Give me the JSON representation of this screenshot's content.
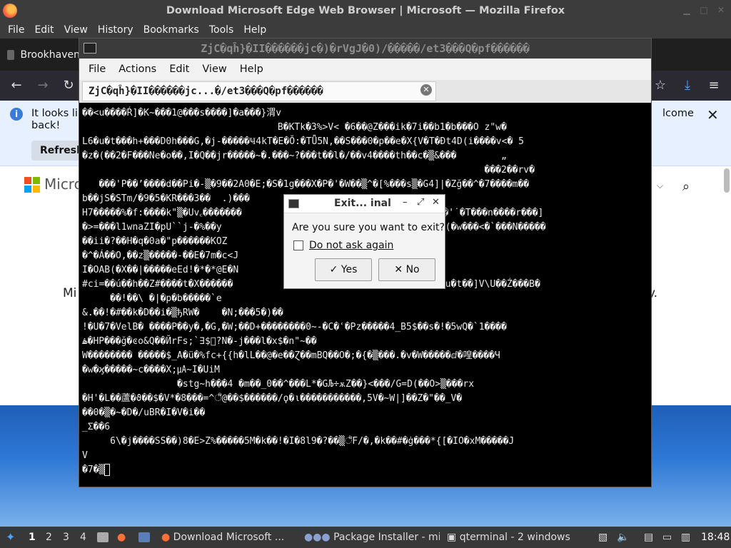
{
  "firefox": {
    "title": "Download Microsoft Edge Web Browser | Microsoft — Mozilla Firefox",
    "menu": [
      "File",
      "Edit",
      "View",
      "History",
      "Bookmarks",
      "Tools",
      "Help"
    ],
    "tab_label": "Brookhaven",
    "notification": {
      "text_left_1": "It looks lik",
      "text_left_2": "back!",
      "text_right": "lcome",
      "refresh_label": "Refresh"
    },
    "page": {
      "brand_fragment": "Micro",
      "text_fragment_left": "Mi",
      "text_fragment_right": "y."
    }
  },
  "terminal": {
    "title": "ZjC�qĥ}�II������jc�)�rVgJ�0)/�����/et3���Q�pf������",
    "menu": [
      "File",
      "Actions",
      "Edit",
      "View",
      "Help"
    ],
    "tab_label": "ZjC�qĥ}�II������jc...�/et3���Q�pf������",
    "lines": [
      "��<u����Ŕ]�K~���1@���s����]�a���}渭v",
      "                                   B�KTk�3%>V< �6��@Z���ik�7i��b1�b���O z\"w�",
      "L6�u�t���h+���D0h���G,�j-�����Ҹ4kT�E�Ŏ:�TǕ5N,��S���0�p��e�X{V�T�Ðt4D(i����v<� 5",
      "�z�(��2�F���Ne�o��,I�Q��jr�����~�.���~?���t��l�/��v4����th��c�▒&���        „",
      "                                                                        ���2��rv�",
      "   ���'P��’����d��Pi�-▒�9��2A0�E;�S�1g���X�P�'�W��▒^�[%���s▒�G4]|�Zğ��^�7����m��",
      "b��jS�STm/�9�5�KR���3��  .)���                                                 ",
      "H7�����%�f:����k\"▒�Uv꜀�������                          �Eŕ��eqJ�$�'˙�T���n����r���]",
      "�>=���l1wnaZI�pU``j-�%��y                               �*�,�:r�g(�w���<�`���N�����",
      "��ii�?��H�q�0a�\"p������KOZ                                                       ",
      "�^�Á��O,��z▒�����-��E�7m�c<J                                   2                 ",
      "I�OAB(�X��|�����eEd!�*�*@E�N                                                       ",
      "#ci=��ú��h��Z#����t�X������                                    6�u�t��]V\\U��Ź���B�",
      "     ��!��\\ �|�p�b�����`e                                                         ",
      "&.��!�#��k�D��i�▒ђRW�    �N;���5�)��",
      "!�U�7�VelB� ����P��y�,�G,�W;��D+��������0~-�C�ʿ�Pz�����4_B5$��s�!�5wQ�`1����",
      "ۿ�HP���ğ�ͼo&Q��ЙrFs;`∃$⃞?N�-j���l�x$�n\"~��",
      "W�������� �����$_A�ü�%fc+{{h�lL��@�e��Ɀ��mBQ��O�;�{�▒���.�v�W�����ⅆ�喤����Ч",
      "�w�ϗ�����~c����X;㎂~I�UiM",
      "                 �stg~h���4 �m��_0��^���L*�GЉ÷ѫZ��}<���/G=D(��O>▒���rx",
      "�H'�L��蘆�ϑ��$�V*�8���=^꣰@��$������/ϙ�ι�����������,5V�~W|]��Z�\"��_V�",
      "��0�▒�~�D�/uBR�I�V�i��",
      "_Σ��6",
      "     6\\�j����SS��)8�E>Z%�����5M�k��!�I�8l9�?��▒꣰F/�,�k��#�ġ���*{[�IO�xM�����J",
      "V",
      "�7�▒"
    ]
  },
  "dialog": {
    "title": "Exit... inal",
    "question": "Are you sure you want to exit?",
    "checkbox_label": "Do not ask again",
    "checkbox_checked": false,
    "yes_label": "Yes",
    "no_label": "No"
  },
  "taskbar": {
    "desktops": [
      "1",
      "2",
      "3",
      "4"
    ],
    "active_desktop": "1",
    "tasks": [
      "Download Microsoft ...",
      "Package Installer - mi...",
      "qterminal - 2 windows"
    ],
    "clock": "18:48"
  },
  "icons": {
    "firefox_logo": "firefox-icon",
    "terminal": "terminal-icon",
    "start_menu": "start-menu-icon"
  }
}
